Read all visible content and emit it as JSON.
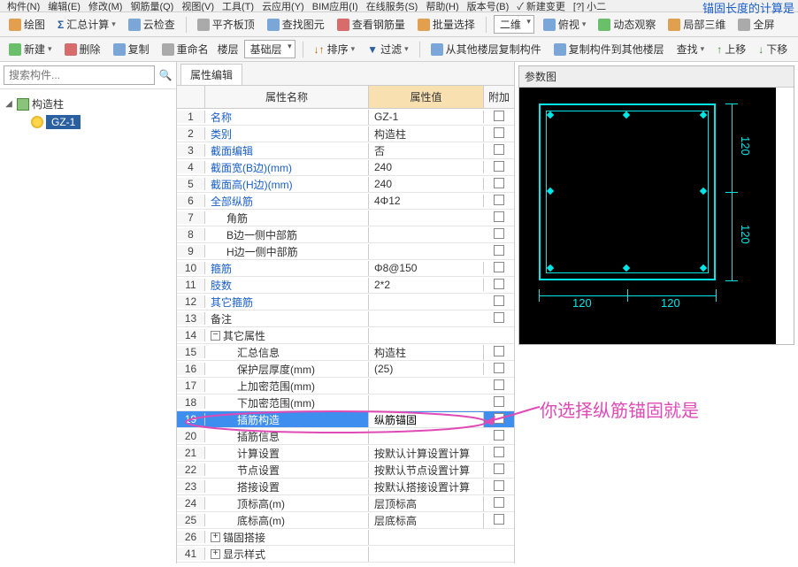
{
  "menubar": [
    "构件(N)",
    "编辑(E)",
    "修改(M)",
    "钢筋量(Q)",
    "视图(V)",
    "工具(T)",
    "云应用(Y)",
    "BIM应用(I)",
    "在线服务(S)",
    "帮助(H)",
    "版本号(B)",
    "✓ 新建变更",
    "[?] 小二"
  ],
  "top_corner": "锚固长度的计算是",
  "toolbar1": {
    "draw": "绘图",
    "sumcalc": "汇总计算",
    "cloudcheck": "云检查",
    "flattop": "平齐板顶",
    "findelem": "查找图元",
    "viewrebar": "查看钢筋量",
    "batchsel": "批量选择",
    "dim_combo": "二维",
    "view_mode": "俯视",
    "dynview": "动态观察",
    "local3d": "局部三维",
    "fullscreen": "全屏"
  },
  "toolbar2": {
    "new": "新建",
    "del": "删除",
    "copy": "复制",
    "rename": "重命名",
    "floor_lbl": "楼层",
    "floor_val": "基础层",
    "sort": "排序",
    "filter": "过滤",
    "copyfrom": "从其他楼层复制构件",
    "copyto": "复制构件到其他楼层",
    "find": "查找",
    "up": "上移",
    "down": "下移"
  },
  "search_placeholder": "搜索构件...",
  "tree": {
    "root": "构造柱",
    "child": "GZ-1"
  },
  "tabs": {
    "active": "属性编辑"
  },
  "grid": {
    "hdr_name": "属性名称",
    "hdr_val": "属性值",
    "hdr_add": "附加",
    "rows": [
      {
        "n": 1,
        "name": "名称",
        "val": "GZ-1",
        "link": true,
        "chk": false
      },
      {
        "n": 2,
        "name": "类别",
        "val": "构造柱",
        "link": true,
        "chk": true
      },
      {
        "n": 3,
        "name": "截面编辑",
        "val": "否",
        "link": true,
        "chk": false
      },
      {
        "n": 4,
        "name": "截面宽(B边)(mm)",
        "val": "240",
        "link": true,
        "chk": true
      },
      {
        "n": 5,
        "name": "截面高(H边)(mm)",
        "val": "240",
        "link": true,
        "chk": true
      },
      {
        "n": 6,
        "name": "全部纵筋",
        "val": "4Φ12",
        "link": true,
        "chk": true
      },
      {
        "n": 7,
        "name": "角筋",
        "val": "",
        "indent": true,
        "chk": true
      },
      {
        "n": 8,
        "name": "B边一侧中部筋",
        "val": "",
        "indent": true,
        "chk": true
      },
      {
        "n": 9,
        "name": "H边一侧中部筋",
        "val": "",
        "indent": true,
        "chk": true
      },
      {
        "n": 10,
        "name": "箍筋",
        "val": "Φ8@150",
        "link": true,
        "chk": true
      },
      {
        "n": 11,
        "name": "肢数",
        "val": "2*2",
        "link": true,
        "chk": true
      },
      {
        "n": 12,
        "name": "其它箍筋",
        "val": "",
        "link": true,
        "chk": false
      },
      {
        "n": 13,
        "name": "备注",
        "val": "",
        "chk": true
      },
      {
        "n": 14,
        "name": "其它属性",
        "group": true,
        "exp": "−"
      },
      {
        "n": 15,
        "name": "汇总信息",
        "val": "构造柱",
        "indent2": true,
        "chk": true
      },
      {
        "n": 16,
        "name": "保护层厚度(mm)",
        "val": "(25)",
        "indent2": true,
        "chk": true
      },
      {
        "n": 17,
        "name": "上加密范围(mm)",
        "val": "",
        "indent2": true,
        "chk": true
      },
      {
        "n": 18,
        "name": "下加密范围(mm)",
        "val": "",
        "indent2": true,
        "chk": true
      },
      {
        "n": 19,
        "name": "插筋构造",
        "val": "纵筋锚固",
        "indent2": true,
        "chk": true,
        "selected": true
      },
      {
        "n": 20,
        "name": "插筋信息",
        "val": "",
        "indent2": true,
        "chk": true
      },
      {
        "n": 21,
        "name": "计算设置",
        "val": "按默认计算设置计算",
        "indent2": true,
        "chk": false
      },
      {
        "n": 22,
        "name": "节点设置",
        "val": "按默认节点设置计算",
        "indent2": true,
        "chk": false
      },
      {
        "n": 23,
        "name": "搭接设置",
        "val": "按默认搭接设置计算",
        "indent2": true,
        "chk": false
      },
      {
        "n": 24,
        "name": "顶标高(m)",
        "val": "层顶标高",
        "indent2": true,
        "chk": true
      },
      {
        "n": 25,
        "name": "底标高(m)",
        "val": "层底标高",
        "indent2": true,
        "chk": true
      },
      {
        "n": 26,
        "name": "锚固搭接",
        "group": true,
        "exp": "+"
      },
      {
        "n": 41,
        "name": "显示样式",
        "group": true,
        "exp": "+"
      }
    ]
  },
  "diagram": {
    "title": "参数图",
    "dim": "120"
  },
  "annotation": "你选择纵筋锚固就是"
}
